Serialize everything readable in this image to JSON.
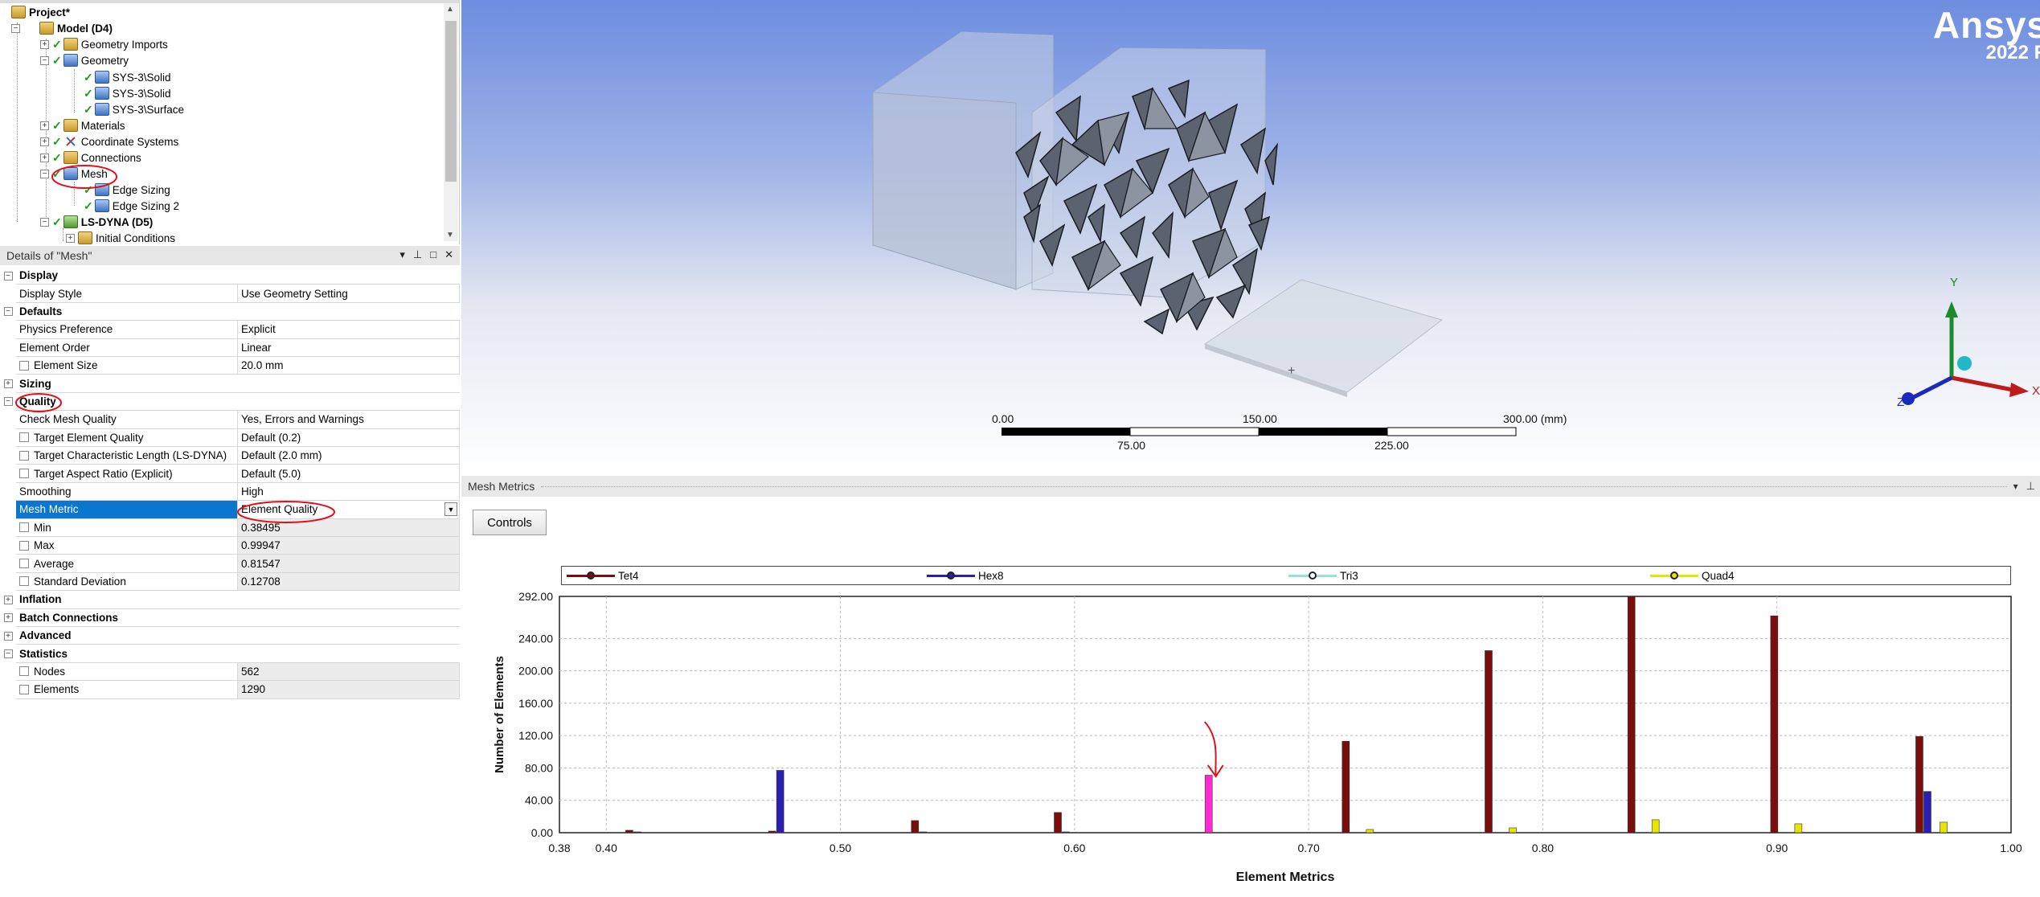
{
  "tree": {
    "items": [
      {
        "label": "Project*",
        "bold": true
      },
      {
        "label": "Model (D4)",
        "bold": true
      },
      {
        "label": "Geometry Imports"
      },
      {
        "label": "Geometry"
      },
      {
        "label": "SYS-3\\Solid"
      },
      {
        "label": "SYS-3\\Solid"
      },
      {
        "label": "SYS-3\\Surface"
      },
      {
        "label": "Materials"
      },
      {
        "label": "Coordinate Systems"
      },
      {
        "label": "Connections"
      },
      {
        "label": "Mesh"
      },
      {
        "label": "Edge Sizing"
      },
      {
        "label": "Edge Sizing 2"
      },
      {
        "label": "LS-DYNA (D5)",
        "bold": true
      },
      {
        "label": "Initial Conditions"
      }
    ]
  },
  "details": {
    "title": "Details of \"Mesh\"",
    "header_buttons": [
      "▾",
      "⊥",
      "□",
      "✕"
    ],
    "rows": [
      {
        "type": "group",
        "label": "Display",
        "exp": "−"
      },
      {
        "label": "Display Style",
        "value": "Use Geometry Setting"
      },
      {
        "type": "group",
        "label": "Defaults",
        "exp": "−"
      },
      {
        "label": "Physics Preference",
        "value": "Explicit"
      },
      {
        "label": "Element Order",
        "value": "Linear"
      },
      {
        "label": "Element Size",
        "value": "20.0 mm",
        "cb": true
      },
      {
        "type": "group",
        "label": "Sizing",
        "exp": "+"
      },
      {
        "type": "group",
        "label": "Quality",
        "exp": "−"
      },
      {
        "label": "Check Mesh Quality",
        "value": "Yes, Errors and Warnings"
      },
      {
        "label": "Target Element Quality",
        "value": "Default (0.2)",
        "cb": true
      },
      {
        "label": "Target Characteristic Length (LS-DYNA)",
        "value": "Default (2.0 mm)",
        "cb": true
      },
      {
        "label": "Target Aspect Ratio (Explicit)",
        "value": "Default (5.0)",
        "cb": true
      },
      {
        "label": "Smoothing",
        "value": "High"
      },
      {
        "label": "Mesh Metric",
        "value": "Element Quality",
        "sel": true,
        "dropdown": true
      },
      {
        "label": "Min",
        "value": "0.38495",
        "cb": true,
        "ro": true
      },
      {
        "label": "Max",
        "value": "0.99947",
        "cb": true,
        "ro": true
      },
      {
        "label": "Average",
        "value": "0.81547",
        "cb": true,
        "ro": true
      },
      {
        "label": "Standard Deviation",
        "value": "0.12708",
        "cb": true,
        "ro": true
      },
      {
        "type": "group",
        "label": "Inflation",
        "exp": "+"
      },
      {
        "type": "group",
        "label": "Batch Connections",
        "exp": "+"
      },
      {
        "type": "group",
        "label": "Advanced",
        "exp": "+"
      },
      {
        "type": "group",
        "label": "Statistics",
        "exp": "−"
      },
      {
        "label": "Nodes",
        "value": "562",
        "cb": true,
        "ro": true
      },
      {
        "label": "Elements",
        "value": "1290",
        "cb": true,
        "ro": true
      }
    ]
  },
  "viewport": {
    "brand_top": "Ansys",
    "brand_bottom": "2022 R",
    "scale_labels_top": [
      "0.00",
      "150.00",
      "300.00 (mm)"
    ],
    "scale_labels_bottom": [
      "75.00",
      "225.00"
    ],
    "triad": {
      "y": "Y",
      "x": "X",
      "z": "Z"
    }
  },
  "mesh_metrics": {
    "panel_title": "Mesh Metrics",
    "controls_label": "Controls",
    "header_buttons": [
      "▾",
      "⊥"
    ]
  },
  "colors": {
    "tet4": "#7a0e0e",
    "hex8": "#2a1fb0",
    "tri3": "#8fe3e6",
    "quad4": "#e6e400",
    "highlight": "#ff2bd1",
    "annotation": "#e0101a"
  },
  "chart_data": {
    "type": "bar",
    "xlabel": "Element Metrics",
    "ylabel": "Number of Elements",
    "xlim": [
      0.38,
      1.0
    ],
    "ylim": [
      0,
      292
    ],
    "xticks": [
      "0.38",
      "0.40",
      "0.50",
      "0.60",
      "0.70",
      "0.80",
      "0.90",
      "1.00"
    ],
    "xtick_values": [
      0.38,
      0.4,
      0.5,
      0.6,
      0.7,
      0.8,
      0.9,
      1.0
    ],
    "yticks": [
      "0.00",
      "40.00",
      "80.00",
      "120.00",
      "160.00",
      "200.00",
      "240.00",
      "292.00"
    ],
    "ytick_values": [
      0,
      40,
      80,
      120,
      160,
      200,
      240,
      292
    ],
    "grid": true,
    "legend_position": "top",
    "bin_centers": [
      0.415,
      0.476,
      0.537,
      0.598,
      0.659,
      0.721,
      0.782,
      0.843,
      0.904,
      0.966
    ],
    "series": [
      {
        "name": "Tet4",
        "color": "#7a0e0e",
        "values": [
          3,
          2,
          15,
          25,
          0,
          113,
          225,
          292,
          268,
          119
        ]
      },
      {
        "name": "Hex8",
        "color": "#2a1fb0",
        "values": [
          1,
          77,
          1,
          1,
          71,
          0,
          0,
          0,
          0,
          51
        ]
      },
      {
        "name": "Tri3",
        "color": "#8fe3e6",
        "values": [
          0,
          0,
          0,
          0,
          0,
          0,
          0,
          0,
          0,
          0
        ]
      },
      {
        "name": "Quad4",
        "color": "#e6e400",
        "values": [
          0,
          0,
          0,
          0,
          0,
          4,
          6,
          16,
          11,
          13
        ]
      }
    ],
    "highlighted": {
      "series": "Hex8",
      "bin": 4,
      "color": "#ff2bd1"
    }
  }
}
